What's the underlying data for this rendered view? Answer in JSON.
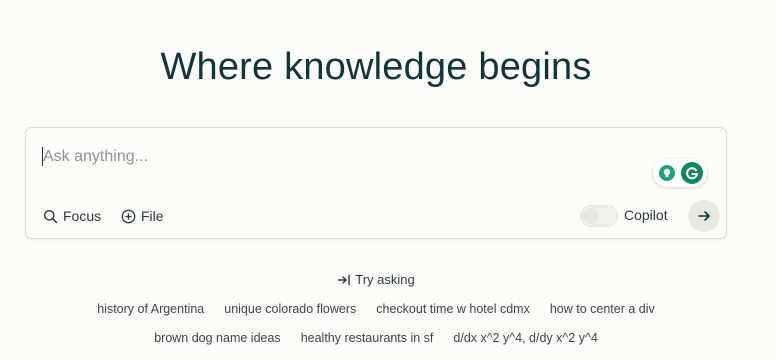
{
  "headline": "Where knowledge begins",
  "ask": {
    "placeholder": "Ask anything...",
    "focus_label": "Focus",
    "file_label": "File",
    "copilot_label": "Copilot",
    "copilot_enabled": false
  },
  "try_asking_label": "Try asking",
  "suggestions_row1": [
    "history of Argentina",
    "unique colorado flowers",
    "checkout time w hotel cdmx",
    "how to center a div"
  ],
  "suggestions_row2": [
    "brown dog name ideas",
    "healthy restaurants in sf",
    "d/dx x^2 y^4, d/dy x^2 y^4"
  ],
  "colors": {
    "background": "#fcfcf9",
    "text": "#13343b",
    "extension_green": "#14865f"
  }
}
